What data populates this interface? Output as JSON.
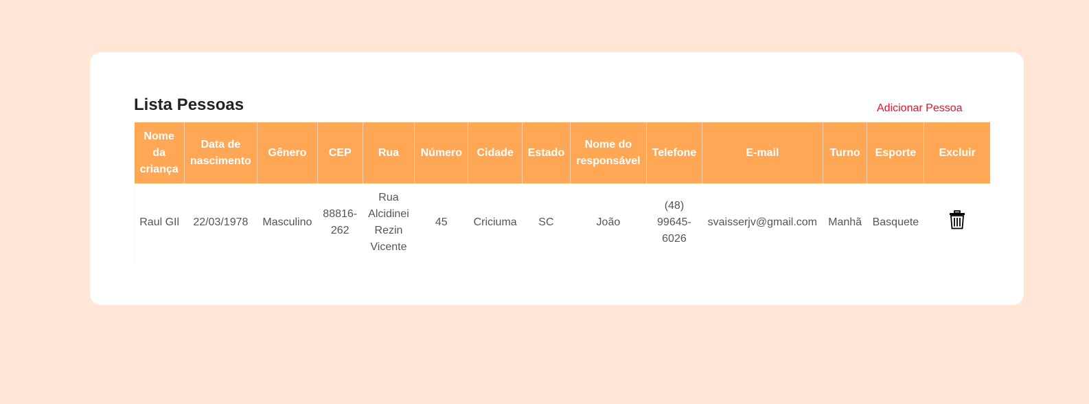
{
  "page": {
    "title": "Lista Pessoas",
    "add_link": "Adicionar Pessoa"
  },
  "table": {
    "headers": [
      "Nome da criança",
      "Data de nascimento",
      "Gênero",
      "CEP",
      "Rua",
      "Número",
      "Cidade",
      "Estado",
      "Nome do responsável",
      "Telefone",
      "E-mail",
      "Turno",
      "Esporte",
      "Excluir"
    ],
    "rows": [
      {
        "nome": "Raul GIl",
        "nascimento": "22/03/1978",
        "genero": "Masculino",
        "cep": "88816-262",
        "rua": "Rua Alcidinei Rezin Vicente",
        "numero": "45",
        "cidade": "Criciuma",
        "estado": "SC",
        "responsavel": "João",
        "telefone": "(48) 99645-6026",
        "email": "svaisserjv@gmail.com",
        "turno": "Manhã",
        "esporte": "Basquete",
        "excluir_icon": "trash-icon"
      }
    ]
  },
  "colors": {
    "background": "#ffe6d6",
    "header": "#ffa755",
    "link": "#e8112d"
  }
}
